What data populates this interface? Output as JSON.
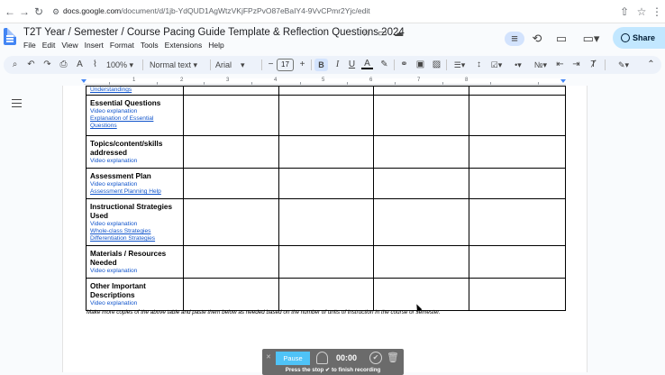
{
  "browser": {
    "url_host": "docs.google.com",
    "url_path": "/document/d/1jb-YdQUD1AgWtzVKjFPzPvO87eBaIY4-9VvCPmr2Yjc/edit"
  },
  "doc": {
    "title": "T2T Year / Semester / Course Pacing Guide Template & Reflection Questions 2024",
    "menus": [
      "File",
      "Edit",
      "View",
      "Insert",
      "Format",
      "Tools",
      "Extensions",
      "Help"
    ],
    "share_label": "Share"
  },
  "toolbar": {
    "zoom": "100%",
    "style": "Normal text",
    "font": "Arial",
    "font_size": "17"
  },
  "ruler": {
    "numbers": [
      "1",
      "2",
      "3",
      "4",
      "5",
      "6",
      "7",
      "8"
    ]
  },
  "table": {
    "top_link": "Understandings",
    "rows": [
      {
        "heading": "Essential Questions",
        "links": [
          "Video explanation",
          "Explanation of Essential",
          "Questions"
        ]
      },
      {
        "heading": "Topics/content/skills addressed",
        "links": [
          "Video explanation"
        ]
      },
      {
        "heading": "Assessment Plan",
        "links": [
          "Video explanation",
          "Assessment Planning Help"
        ]
      },
      {
        "heading": "Instructional Strategies Used",
        "links": [
          "Video explanation",
          "Whole-class Strategies",
          "Differentiation Strategies"
        ]
      },
      {
        "heading": "Materials / Resources Needed",
        "links": [
          "Video explanation"
        ]
      },
      {
        "heading": "Other Important Descriptions",
        "links": [
          "Video explanation"
        ]
      }
    ]
  },
  "note": "Make more copies of the above table and paste them below as needed based on the number of units of instruction in the course or semester.",
  "recorder": {
    "pause_label": "Pause",
    "time": "00:00",
    "hint": "Press the stop ✔ to finish recording"
  }
}
